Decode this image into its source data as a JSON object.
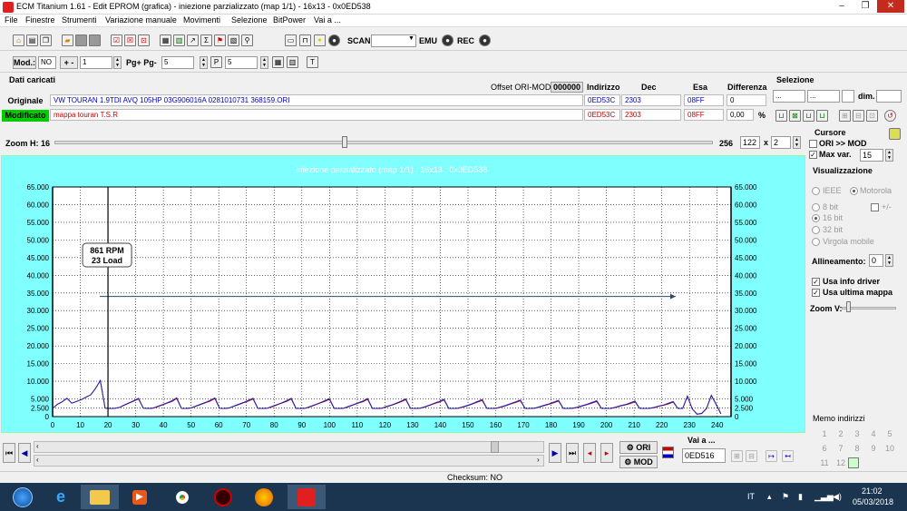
{
  "window": {
    "title": "ECM Titanium 1.61 - Edit EPROM (grafica) - iniezione parzializzato (map 1/1) - 16x13 - 0x0ED538",
    "minimize": "–",
    "maximize": "❐",
    "close": "✕"
  },
  "menu": [
    "File",
    "Finestre",
    "Strumenti",
    "Variazione manuale",
    "Movimenti",
    "Selezione",
    "BitPower",
    "Vai a ..."
  ],
  "toolbar1": {
    "scan_label": "SCAN",
    "emu_label": "EMU",
    "rec_label": "REC"
  },
  "toolbar2": {
    "mod_label": "Mod.:",
    "mod_value": "NO",
    "plusminus": "+ -",
    "step_value": "1",
    "pg_label": "Pg+ Pg-",
    "pg_value": "5",
    "p_value": "5"
  },
  "data_header": {
    "dati_caricati": "Dati caricati",
    "offset_label": "Offset ORI-MOD",
    "offset_value": "000000",
    "col_indirizzo": "Indirizzo",
    "col_dec": "Dec",
    "col_esa": "Esa",
    "col_differenza": "Differenza",
    "selezione": "Selezione",
    "sel_a": "...",
    "sel_b": "...",
    "dim_label": "dim."
  },
  "rows": {
    "originale": {
      "label": "Originale",
      "file": "VW TOURAN 1.9TDI AVQ 105HP 03G906016A 0281010731 368159.ORI",
      "indirizzo": "0ED53C",
      "dec": "2303",
      "esa": "08FF",
      "diff": "0"
    },
    "modificato": {
      "label": "Modificato",
      "file": "mappa touran T.S.R",
      "indirizzo": "0ED53C",
      "dec": "2303",
      "esa": "08FF",
      "diff": "0,00",
      "pct": "%"
    }
  },
  "zoom": {
    "label": "Zoom H: 16",
    "max": "256",
    "w": "122",
    "x": "x",
    "h": "2"
  },
  "cursore": {
    "title": "Cursore",
    "ori_mod": "ORI >> MOD",
    "maxvar": "Max var.",
    "maxvar_value": "15"
  },
  "visualizzazione": {
    "title": "Visualizzazione",
    "ieee": "IEEE",
    "motorola": "Motorola",
    "bit8": "8 bit",
    "plusminus": "+/-",
    "bit16": "16 bit",
    "bit32": "32 bit",
    "virgola": "Virgola mobile",
    "allineamento": "Allineamento:",
    "allineamento_value": "0",
    "usa_info": "Usa info driver",
    "usa_ultima": "Usa ultima mappa",
    "zoomv": "Zoom V:"
  },
  "memo": {
    "title": "Memo indirizzi",
    "nums": [
      "1",
      "2",
      "3",
      "4",
      "5",
      "6",
      "7",
      "8",
      "9",
      "10",
      "11",
      "12"
    ]
  },
  "bottom": {
    "vai_label": "Vai a ...",
    "vai_value": "0ED516",
    "ori": "ORI",
    "mod": "MOD"
  },
  "status": {
    "checksum": "Checksum: NO"
  },
  "tray": {
    "lang": "IT",
    "time": "21:02",
    "date": "05/03/2018"
  },
  "chart_data": {
    "type": "line",
    "title": "iniezione parzializzato (map 1/1) : 16x13 : 0x0ED538",
    "xlim": [
      0,
      245
    ],
    "ylim": [
      0,
      65000
    ],
    "xticks": [
      0,
      10,
      20,
      30,
      40,
      50,
      60,
      70,
      80,
      90,
      100,
      110,
      120,
      130,
      140,
      150,
      160,
      170,
      180,
      190,
      200,
      210,
      220,
      230,
      240
    ],
    "yticks": [
      0,
      2500,
      5000,
      10000,
      15000,
      20000,
      25000,
      30000,
      35000,
      40000,
      45000,
      50000,
      55000,
      60000,
      65000
    ],
    "ytick_labels": [
      "0",
      "2.500",
      "5.000",
      "10.000",
      "15.000",
      "20.000",
      "25.000",
      "30.000",
      "35.000",
      "40.000",
      "45.000",
      "50.000",
      "55.000",
      "60.000",
      "65.000"
    ],
    "grid": true,
    "cursor_x": 20,
    "tooltip": {
      "line1": "861 RPM",
      "line2": "23 Load"
    },
    "arrow": {
      "x_start": 17,
      "x_end": 225,
      "y": 34000
    },
    "series": [
      {
        "color": "#c00000",
        "values": [
          2300,
          3500,
          4200,
          5200,
          3800,
          4300,
          4800,
          5500,
          6200,
          8000,
          10200,
          2400,
          2300,
          2350,
          2600,
          3200,
          3800,
          4400,
          5000,
          2400,
          2300,
          2400,
          2800,
          3300,
          3800,
          4300,
          5100,
          2300,
          2300,
          2450,
          2900,
          3400,
          3900,
          4400,
          5100,
          2300,
          2300,
          2450,
          2900,
          3400,
          3900,
          4400,
          5000,
          2300,
          2300,
          2400,
          2800,
          3300,
          3800,
          4300,
          5000,
          2300,
          2300,
          2400,
          2800,
          3300,
          3800,
          4300,
          4900,
          2300,
          2300,
          2400,
          2800,
          3300,
          3800,
          4200,
          4900,
          2300,
          2300,
          2400,
          2800,
          3200,
          3700,
          4200,
          4800,
          2300,
          2300,
          2400,
          2700,
          3200,
          3700,
          4100,
          4700,
          2300,
          2300,
          2400,
          2700,
          3100,
          3600,
          4100,
          4600,
          2300,
          2300,
          2400,
          2700,
          3100,
          3600,
          4000,
          4500,
          2300,
          2300,
          2400,
          2700,
          3100,
          3500,
          3900,
          4400,
          2300,
          2300,
          2400,
          2600,
          3000,
          3400,
          3800,
          4300,
          2300,
          2300,
          2350,
          2600,
          3000,
          3300,
          3700,
          4200,
          2300,
          2300,
          2350,
          2500,
          2900,
          3200,
          3600,
          4100,
          2300,
          2300,
          5800,
          2200,
          700,
          900,
          2300,
          6000,
          3500,
          800
        ]
      },
      {
        "color": "#2020c0",
        "values": [
          2300,
          3500,
          4200,
          5200,
          3800,
          4300,
          4800,
          5500,
          6200,
          8000,
          10200,
          2400,
          2300,
          2350,
          2600,
          3300,
          3900,
          4500,
          5200,
          2400,
          2300,
          2400,
          2900,
          3400,
          3900,
          4500,
          5300,
          2300,
          2300,
          2450,
          3000,
          3500,
          4000,
          4600,
          5300,
          2300,
          2300,
          2450,
          3000,
          3500,
          4000,
          4600,
          5200,
          2300,
          2300,
          2400,
          2900,
          3400,
          3900,
          4500,
          5200,
          2300,
          2300,
          2400,
          2900,
          3400,
          3900,
          4500,
          5100,
          2300,
          2300,
          2400,
          2900,
          3400,
          3900,
          4400,
          5100,
          2300,
          2300,
          2400,
          2900,
          3300,
          3800,
          4400,
          5000,
          2300,
          2300,
          2400,
          2800,
          3300,
          3800,
          4300,
          4900,
          2300,
          2300,
          2400,
          2800,
          3200,
          3700,
          4300,
          4800,
          2300,
          2300,
          2400,
          2800,
          3200,
          3700,
          4200,
          4700,
          2300,
          2300,
          2400,
          2800,
          3200,
          3600,
          4100,
          4600,
          2300,
          2300,
          2400,
          2700,
          3100,
          3500,
          4000,
          4500,
          2300,
          2300,
          2350,
          2700,
          3100,
          3400,
          3900,
          4400,
          2300,
          2300,
          2350,
          2600,
          3000,
          3300,
          3800,
          4300,
          2300,
          2300,
          5800,
          2200,
          700,
          900,
          2300,
          6000,
          3500,
          800
        ]
      }
    ]
  }
}
